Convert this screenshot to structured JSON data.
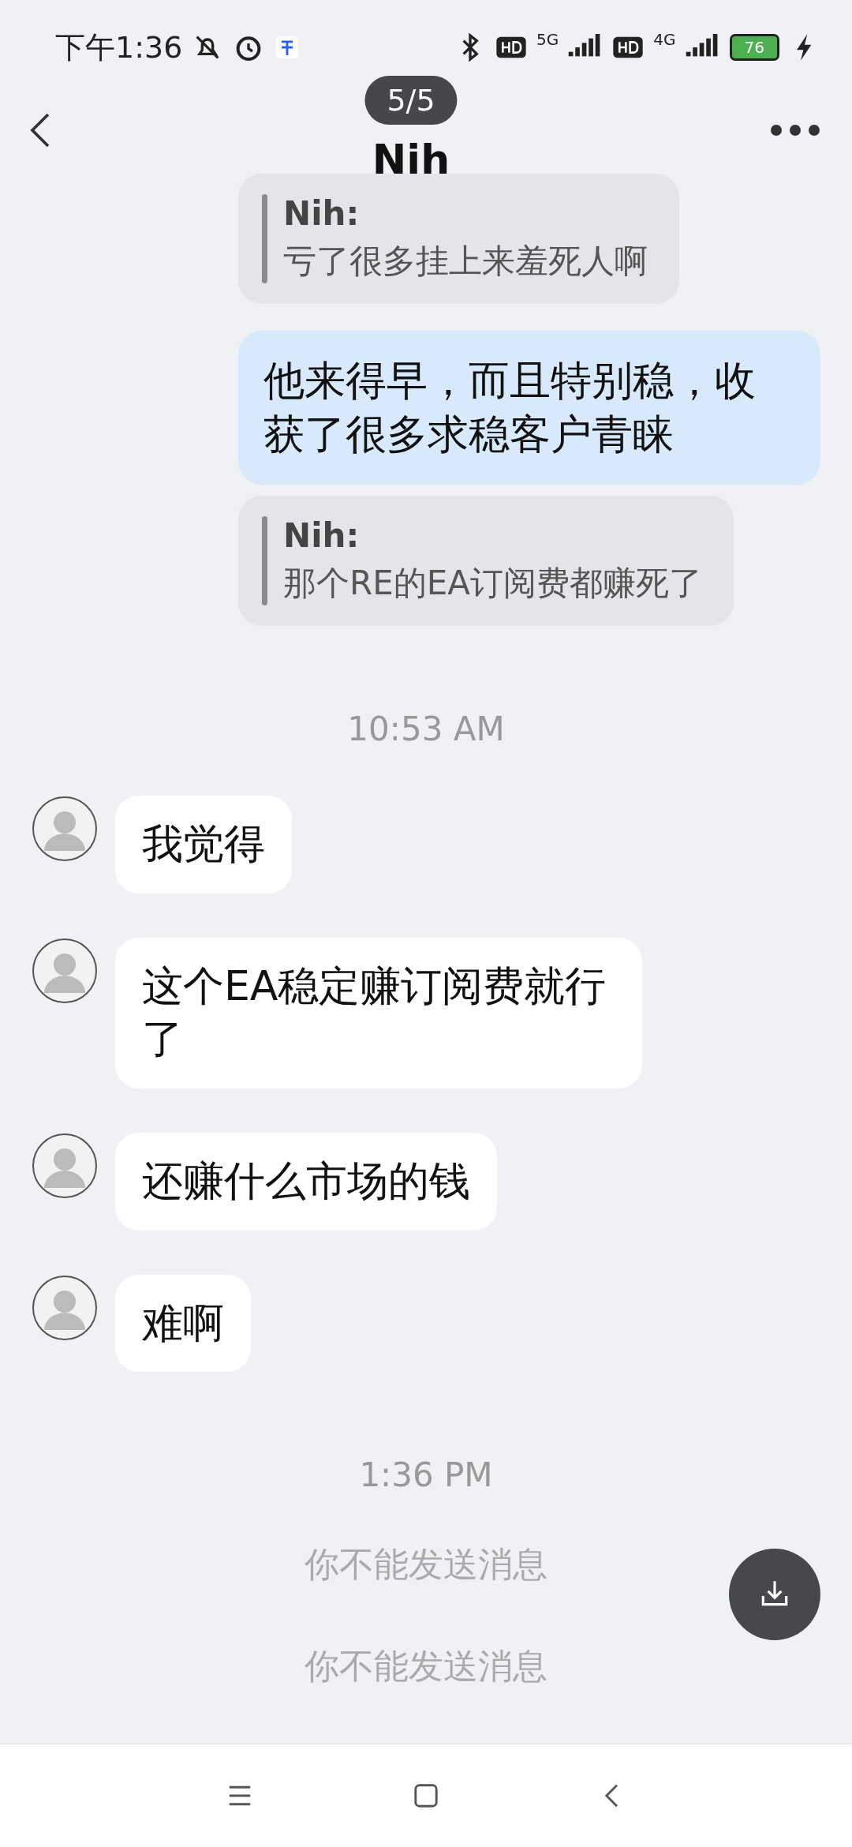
{
  "status_bar": {
    "time": "下午1:36",
    "network_1": "5G",
    "network_2": "4G",
    "battery": "76"
  },
  "header": {
    "title": "Nih",
    "overlay_counter": "5/5"
  },
  "messages": [
    {
      "kind": "quote",
      "author": "Nih:",
      "text": "亏了很多挂上来羞死人啊"
    },
    {
      "kind": "outgoing",
      "text": "他来得早，而且特别稳，收获了很多求稳客户青睐"
    },
    {
      "kind": "quote",
      "author": "Nih:",
      "text": "那个RE的EA订阅费都赚死了"
    },
    {
      "kind": "time",
      "text": "10:53 AM"
    },
    {
      "kind": "incoming",
      "text": "我觉得"
    },
    {
      "kind": "incoming",
      "text": "这个EA稳定赚订阅费就行了"
    },
    {
      "kind": "incoming",
      "text": "还赚什么市场的钱"
    },
    {
      "kind": "incoming",
      "text": "难啊"
    },
    {
      "kind": "time",
      "text": "1:36 PM"
    },
    {
      "kind": "notice",
      "text": "你不能发送消息"
    },
    {
      "kind": "notice",
      "text": "你不能发送消息"
    }
  ]
}
